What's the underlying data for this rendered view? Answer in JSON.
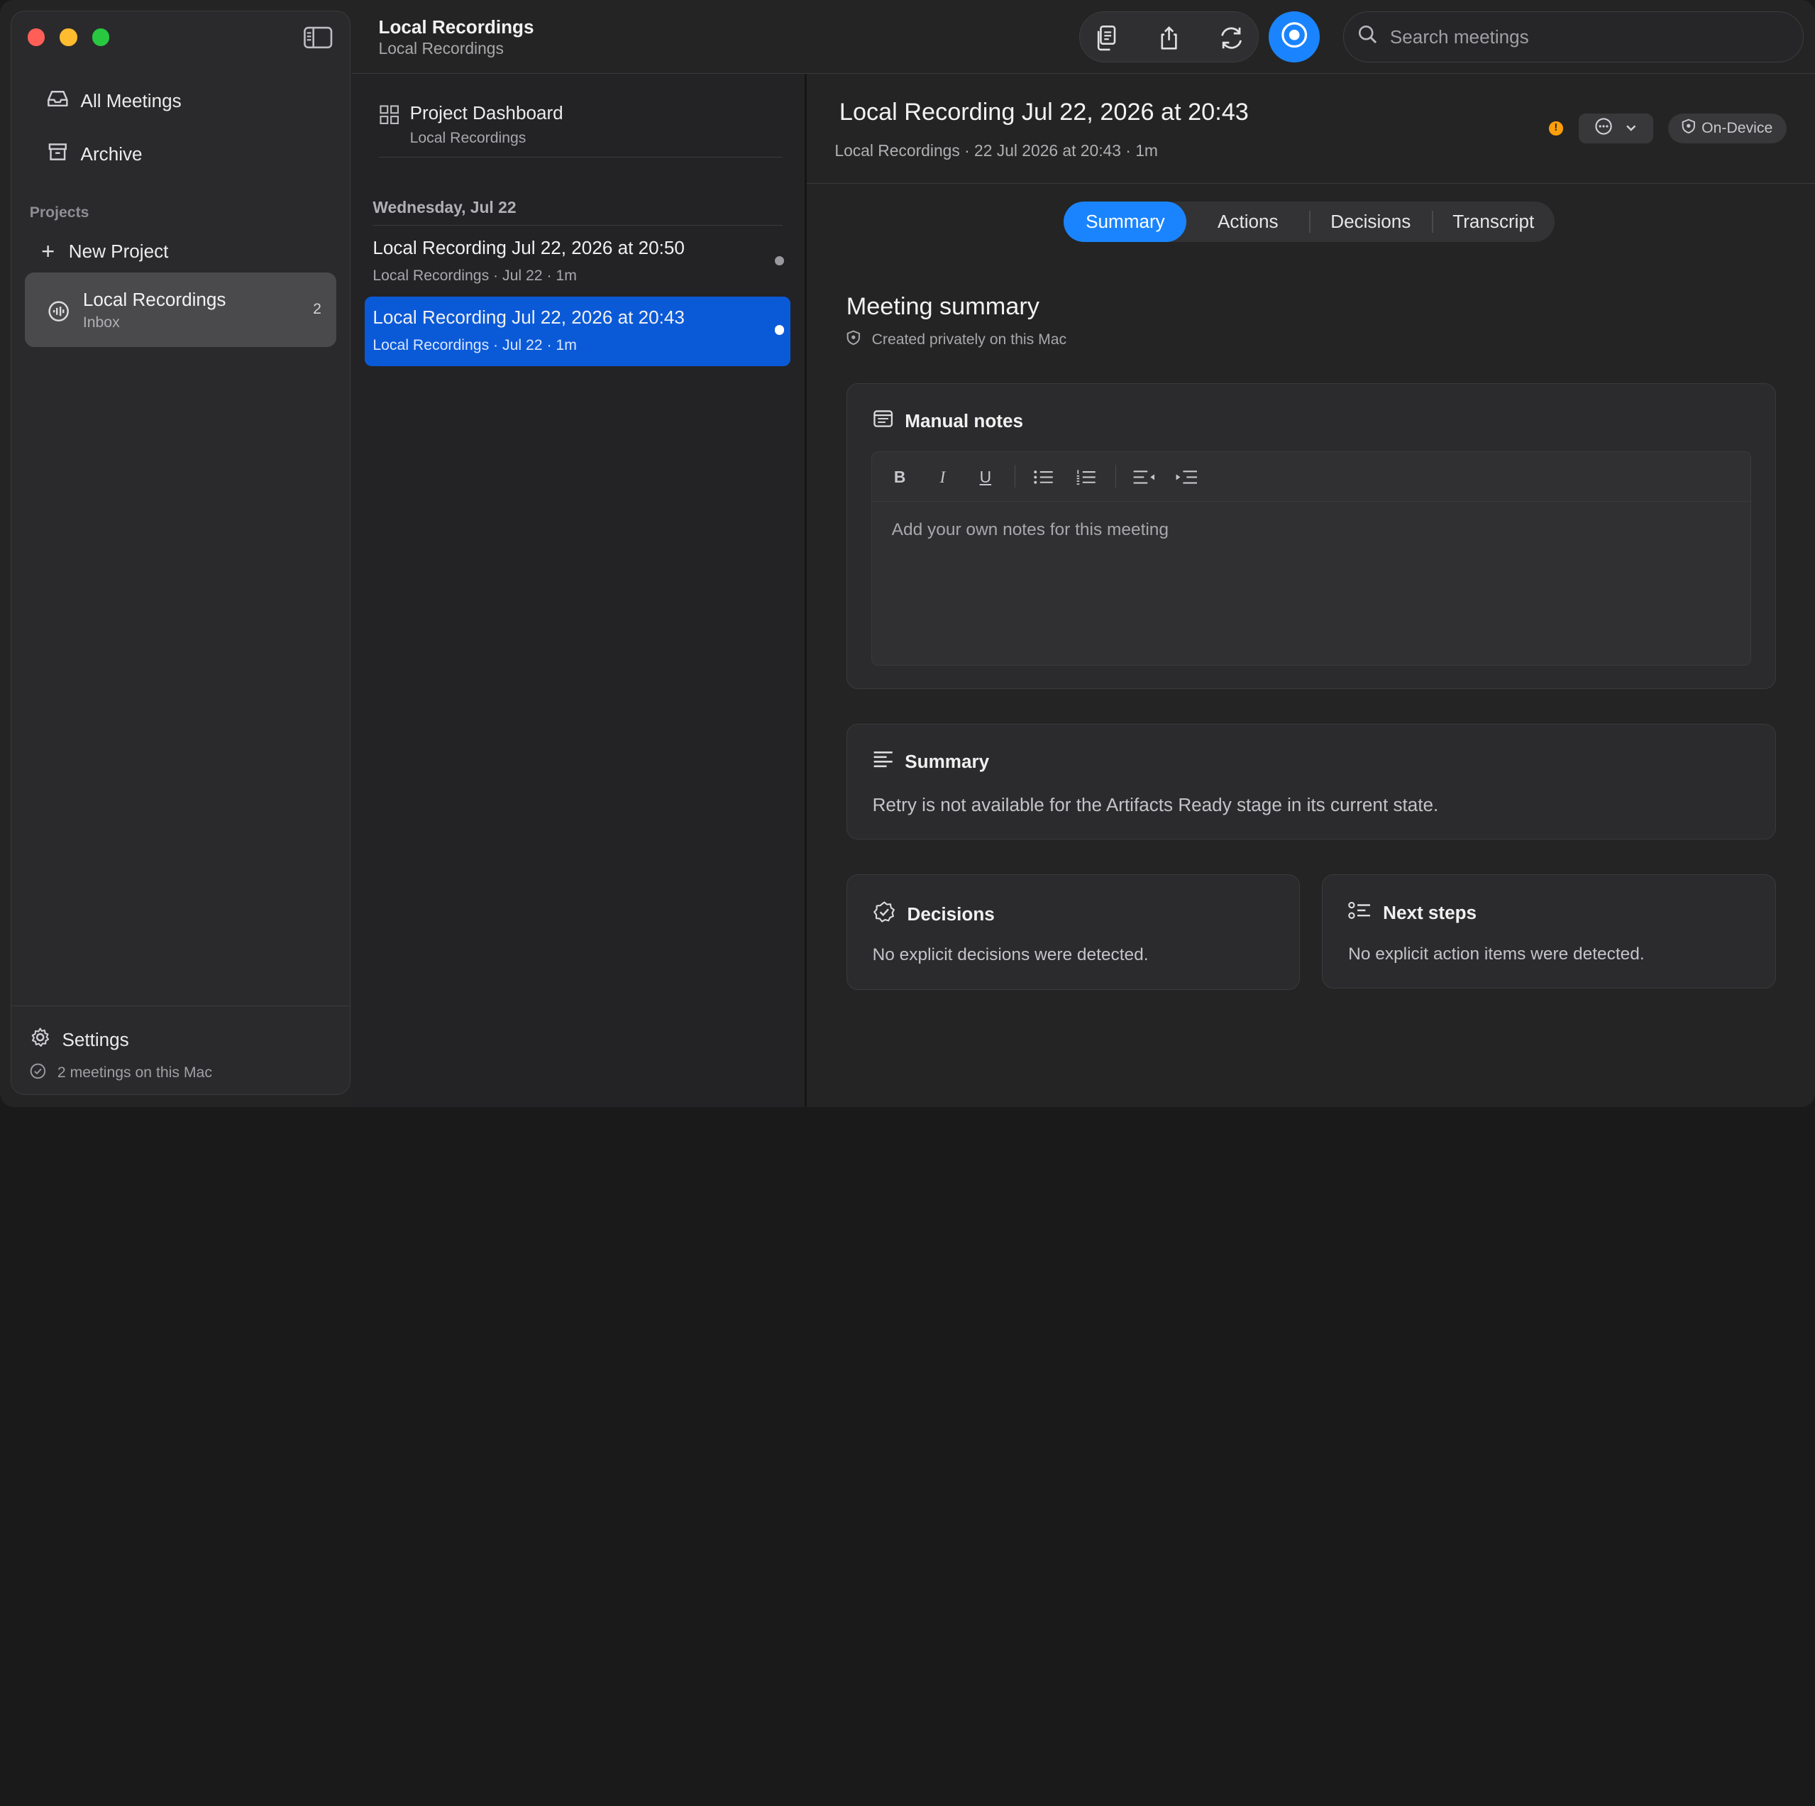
{
  "window": {
    "title": "Local Recordings",
    "subtitle": "Local Recordings"
  },
  "sidebar": {
    "nav": [
      {
        "label": "All Meetings",
        "icon": "tray-icon"
      },
      {
        "label": "Archive",
        "icon": "archive-icon"
      }
    ],
    "projects_label": "Projects",
    "new_project_label": "New Project",
    "project": {
      "title": "Local Recordings",
      "subtitle": "Inbox",
      "count": "2",
      "icon": "waveform-icon"
    },
    "footer": {
      "settings_label": "Settings",
      "status": "2 meetings on this Mac"
    }
  },
  "toolbar": {
    "buttons": [
      "copy-icon",
      "share-icon",
      "sync-icon"
    ],
    "record_icon": "record-icon",
    "search_placeholder": "Search meetings"
  },
  "list": {
    "dashboard": {
      "title": "Project Dashboard",
      "subtitle": "Local Recordings"
    },
    "group_header": "Wednesday, Jul 22",
    "items": [
      {
        "title": "Local Recording Jul 22, 2026 at 20:50",
        "meta": "Local Recordings · Jul 22 · 1m",
        "selected": false
      },
      {
        "title": "Local Recording Jul 22, 2026 at 20:43",
        "meta": "Local Recordings · Jul 22 · 1m",
        "selected": true
      }
    ]
  },
  "detail": {
    "title": "Local Recording Jul 22, 2026 at 20:43",
    "meta": "Local Recordings · 22 Jul 2026 at 20:43 · 1m",
    "warning_glyph": "!",
    "on_device_label": "On-Device",
    "tabs": [
      "Summary",
      "Actions",
      "Decisions",
      "Transcript"
    ],
    "active_tab": "Summary",
    "section_title": "Meeting summary",
    "section_subtitle": "Created privately on this Mac",
    "manual_notes": {
      "title": "Manual notes",
      "placeholder": "Add your own notes for this meeting",
      "format_buttons": [
        "B",
        "I",
        "U"
      ]
    },
    "summary": {
      "title": "Summary",
      "body": "Retry is not available for the Artifacts Ready stage in its current state."
    },
    "decisions": {
      "title": "Decisions",
      "body": "No explicit decisions were detected."
    },
    "next_steps": {
      "title": "Next steps",
      "body": "No explicit action items were detected."
    }
  },
  "colors": {
    "accent": "#1a84ff",
    "selection": "#0a5ad8",
    "warning": "#ff9f0a"
  }
}
